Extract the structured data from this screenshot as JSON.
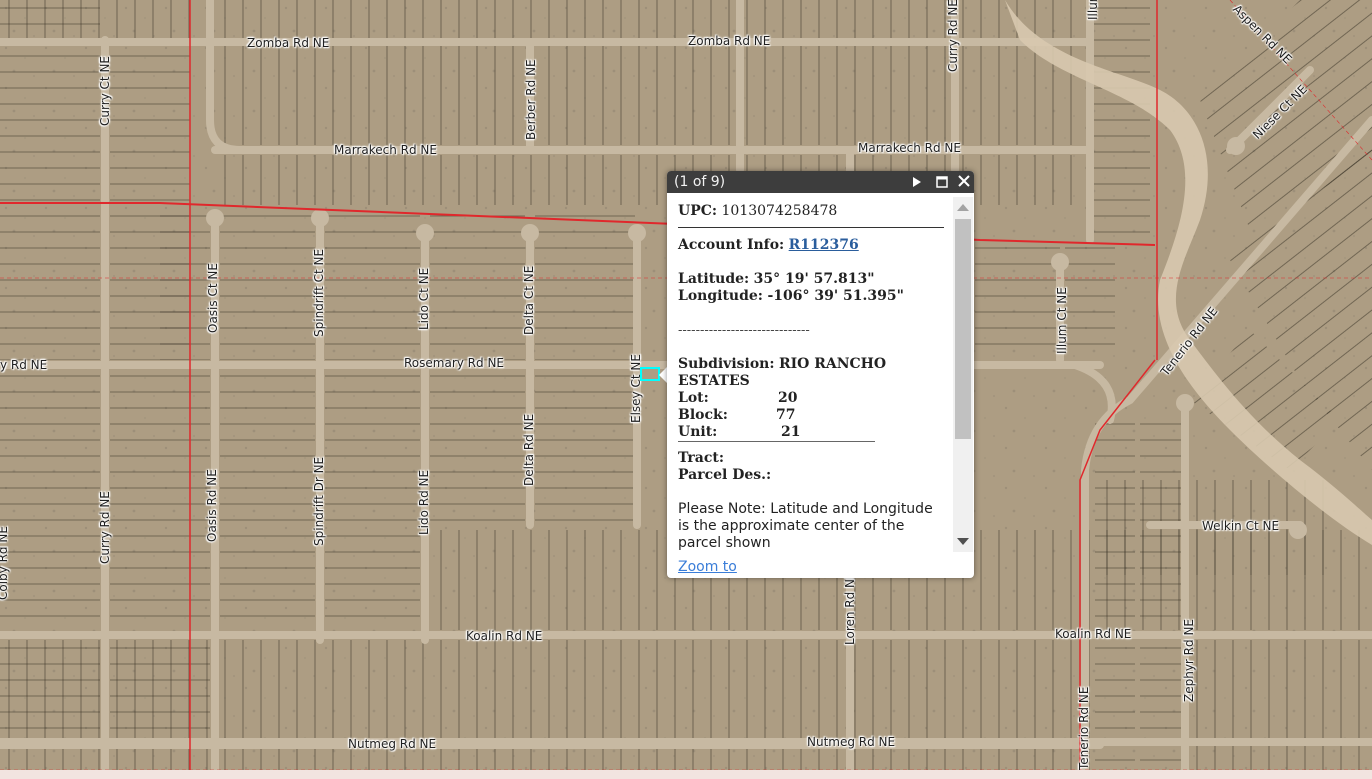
{
  "map": {
    "streets": [
      {
        "id": "zomba-rd-w",
        "label": "Zomba Rd NE"
      },
      {
        "id": "zomba-rd-e",
        "label": "Zomba Rd NE"
      },
      {
        "id": "curry-ct",
        "label": "Curry Ct NE"
      },
      {
        "id": "curry-rd",
        "label": "Curry Rd NE"
      },
      {
        "id": "curry-rd-2",
        "label": "Curry Rd NE"
      },
      {
        "id": "berber-rd",
        "label": "Berber Rd NE"
      },
      {
        "id": "marrakech-rd-w",
        "label": "Marrakech Rd NE"
      },
      {
        "id": "marrakech-rd-e",
        "label": "Marrakech Rd NE"
      },
      {
        "id": "niese-ct",
        "label": "Niese Ct NE"
      },
      {
        "id": "oasis-ct",
        "label": "Oasis Ct NE"
      },
      {
        "id": "spindrift-ct",
        "label": "Spindrift Ct NE"
      },
      {
        "id": "lido-ct",
        "label": "Lido Ct NE"
      },
      {
        "id": "delta-ct",
        "label": "Delta Ct NE"
      },
      {
        "id": "rosemary-rd",
        "label": "Rosemary Rd NE"
      },
      {
        "id": "rosemary-rd-w",
        "label": "y Rd NE"
      },
      {
        "id": "elsey-ct",
        "label": "Elsey Ct NE"
      },
      {
        "id": "illum-ct",
        "label": "Illum Ct NE"
      },
      {
        "id": "tenerio-rd",
        "label": "Tenerio Rd NE"
      },
      {
        "id": "tenerio-rd-2",
        "label": "Tenerio Rd NE"
      },
      {
        "id": "oasis-rd",
        "label": "Oasis Rd NE"
      },
      {
        "id": "spindrift-dr",
        "label": "Spindrift Dr NE"
      },
      {
        "id": "lido-rd",
        "label": "Lido Rd NE"
      },
      {
        "id": "delta-rd",
        "label": "Delta Rd NE"
      },
      {
        "id": "welkin-ct",
        "label": "Welkin Ct NE"
      },
      {
        "id": "koalin-rd-w",
        "label": "Koalin Rd NE"
      },
      {
        "id": "koalin-rd-e",
        "label": "Koalin Rd NE"
      },
      {
        "id": "loren-rd",
        "label": "Loren Rd NE"
      },
      {
        "id": "zephyr-rd",
        "label": "Zephyr Rd NE"
      },
      {
        "id": "nutmeg-rd-w",
        "label": "Nutmeg Rd NE"
      },
      {
        "id": "nutmeg-rd-e",
        "label": "Nutmeg Rd NE"
      },
      {
        "id": "colby-rd",
        "label": "Colby Rd NE"
      },
      {
        "id": "illum-rd",
        "label": "Illum"
      },
      {
        "id": "aspen-rd",
        "label": "Aspen Rd NE"
      }
    ]
  },
  "popup": {
    "title": "(1 of 9)",
    "upc_label": "UPC:",
    "upc_value": "1013074258478",
    "account_label": "Account Info:",
    "account_link": "R112376",
    "latitude_label": "Latitude:",
    "latitude_value": "35° 19' 57.813\"",
    "longitude_label": "Longitude:",
    "longitude_value": "-106° 39' 51.395\"",
    "dashes": "------------------------------",
    "subdivision_label": "Subdivision:",
    "subdivision_value": "RIO RANCHO",
    "subdivision_value_2": "ESTATES",
    "lot_label": "Lot:",
    "lot_value": "20",
    "block_label": "Block:",
    "block_value": "77",
    "unit_label": "Unit:",
    "unit_value": "21",
    "tract_label": "Tract:",
    "parcel_des_label": "Parcel Des.:",
    "note": "Please Note: Latitude and Longitude is the approximate center of the parcel shown",
    "zoom_to": "Zoom to"
  },
  "colors": {
    "terrain": "#ad9d83",
    "road": "#c7b9a2",
    "boundary": "#e0282c",
    "parcel_line": "#3a3428",
    "wash": "#d8c9af",
    "highlight": "#00ffff"
  }
}
